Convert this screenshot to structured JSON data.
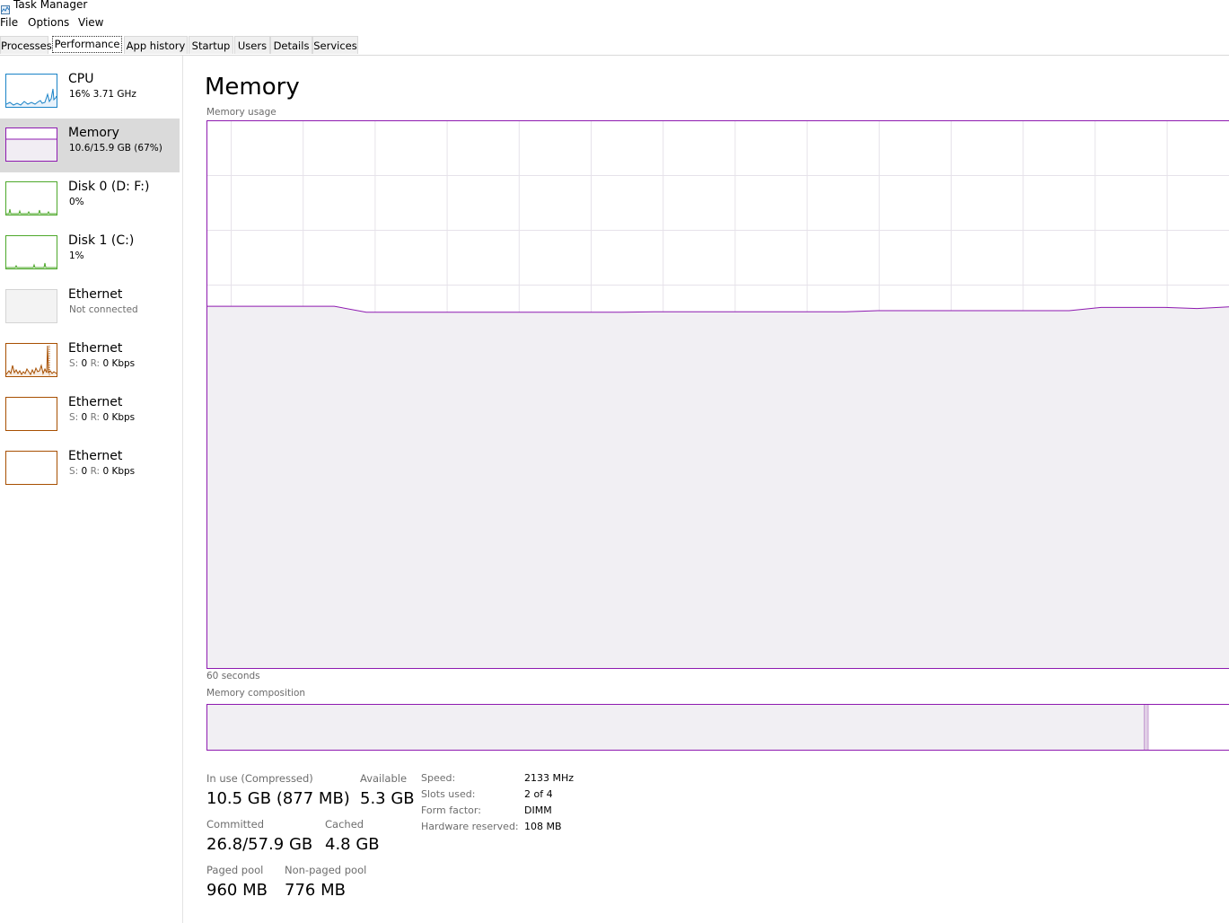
{
  "window": {
    "title": "Task Manager",
    "icon": "task-manager-icon"
  },
  "menu": [
    "File",
    "Options",
    "View"
  ],
  "tabs": [
    {
      "label": "Processes",
      "active": false
    },
    {
      "label": "Performance",
      "active": true
    },
    {
      "label": "App history",
      "active": false
    },
    {
      "label": "Startup",
      "active": false
    },
    {
      "label": "Users",
      "active": false
    },
    {
      "label": "Details",
      "active": false
    },
    {
      "label": "Services",
      "active": false
    }
  ],
  "sidebar": {
    "items": [
      {
        "title": "CPU",
        "subtitle": "16%  3.71 GHz",
        "color": "#1a83c7",
        "selected": false
      },
      {
        "title": "Memory",
        "subtitle": "10.6/15.9 GB (67%)",
        "color": "#8e1ab0",
        "selected": true
      },
      {
        "title": "Disk 0 (D: F:)",
        "subtitle": "0%",
        "color": "#4da82a",
        "selected": false
      },
      {
        "title": "Disk 1 (C:)",
        "subtitle": "1%",
        "color": "#4da82a",
        "selected": false
      },
      {
        "title": "Ethernet",
        "subtitle": "Not connected",
        "color": "#cfcfcf",
        "selected": false
      },
      {
        "title": "Ethernet",
        "sub_s": "S:",
        "sub_s_val": "0",
        "sub_r": "R:",
        "sub_r_val": "0 Kbps",
        "color": "#a74f01",
        "selected": false
      },
      {
        "title": "Ethernet",
        "sub_s": "S:",
        "sub_s_val": "0",
        "sub_r": "R:",
        "sub_r_val": "0 Kbps",
        "color": "#a74f01",
        "selected": false
      },
      {
        "title": "Ethernet",
        "sub_s": "S:",
        "sub_s_val": "0",
        "sub_r": "R:",
        "sub_r_val": "0 Kbps",
        "color": "#a74f01",
        "selected": false
      }
    ]
  },
  "main": {
    "title": "Memory",
    "usage_label": "Memory usage",
    "time_label": "60 seconds",
    "composition_label": "Memory composition",
    "stats": {
      "in_use_label": "In use (Compressed)",
      "in_use_value": "10.5 GB (877 MB)",
      "available_label": "Available",
      "available_value": "5.3 GB",
      "committed_label": "Committed",
      "committed_value": "26.8/57.9 GB",
      "cached_label": "Cached",
      "cached_value": "4.8 GB",
      "paged_label": "Paged pool",
      "paged_value": "960 MB",
      "nonpaged_label": "Non-paged pool",
      "nonpaged_value": "776 MB"
    },
    "specs": [
      {
        "label": "Speed:",
        "value": "2133 MHz"
      },
      {
        "label": "Slots used:",
        "value": "2 of 4"
      },
      {
        "label": "Form factor:",
        "value": "DIMM"
      },
      {
        "label": "Hardware reserved:",
        "value": "108 MB"
      }
    ]
  },
  "chart_data": {
    "type": "area",
    "xlabel": "60 seconds",
    "ylim": [
      0,
      100
    ],
    "usage_percent_series": [
      66.1,
      66.1,
      66.1,
      66.1,
      66.1,
      65.0,
      65.0,
      65.0,
      65.0,
      65.0,
      65.0,
      65.0,
      65.0,
      65.0,
      65.1,
      65.1,
      65.1,
      65.1,
      65.1,
      65.1,
      65.1,
      65.3,
      65.3,
      65.3,
      65.3,
      65.3,
      65.3,
      65.3,
      65.9,
      65.9,
      65.9,
      65.7,
      66.0
    ],
    "color": "#8e1ab0",
    "composition_in_use_fraction": 0.917,
    "composition_modified_fraction": 0.004,
    "composition_standby_fraction": 0.079
  }
}
